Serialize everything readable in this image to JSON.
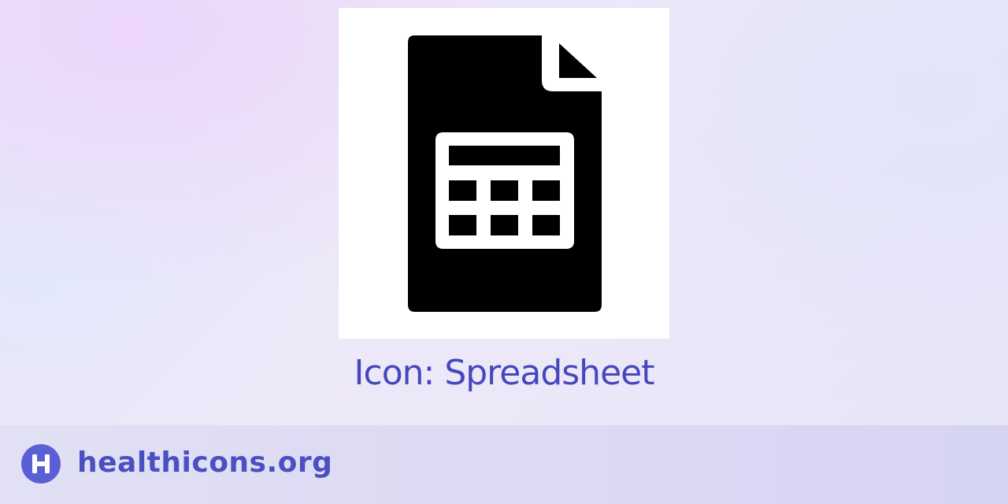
{
  "icon": {
    "name": "spreadsheet-icon",
    "title": "Icon: Spreadsheet",
    "foreground": "#000000",
    "background": "#ffffff"
  },
  "footer": {
    "brand_name": "healthicons.org",
    "logo_icon": "healthicons-h-logo",
    "accent": "#5b5fd6"
  },
  "colors": {
    "title_text": "#4548bd",
    "brand_text": "#4a4fc2",
    "footer_bg": "#dcdaf3"
  }
}
